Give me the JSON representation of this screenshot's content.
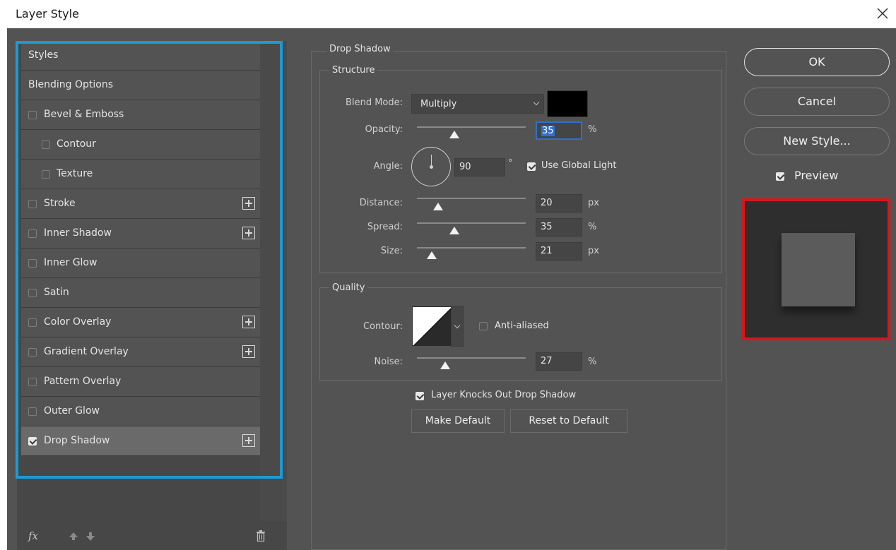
{
  "window": {
    "title": "Layer Style"
  },
  "styles_list": {
    "items": [
      {
        "label": "Styles",
        "checkbox": false,
        "checked": false,
        "add": false,
        "selected": false,
        "indent": 0
      },
      {
        "label": "Blending Options",
        "checkbox": false,
        "checked": false,
        "add": false,
        "selected": false,
        "indent": 0
      },
      {
        "label": "Bevel & Emboss",
        "checkbox": true,
        "checked": false,
        "add": false,
        "selected": false,
        "indent": 0
      },
      {
        "label": "Contour",
        "checkbox": true,
        "checked": false,
        "add": false,
        "selected": false,
        "indent": 1
      },
      {
        "label": "Texture",
        "checkbox": true,
        "checked": false,
        "add": false,
        "selected": false,
        "indent": 1
      },
      {
        "label": "Stroke",
        "checkbox": true,
        "checked": false,
        "add": true,
        "selected": false,
        "indent": 0
      },
      {
        "label": "Inner Shadow",
        "checkbox": true,
        "checked": false,
        "add": true,
        "selected": false,
        "indent": 0
      },
      {
        "label": "Inner Glow",
        "checkbox": true,
        "checked": false,
        "add": false,
        "selected": false,
        "indent": 0
      },
      {
        "label": "Satin",
        "checkbox": true,
        "checked": false,
        "add": false,
        "selected": false,
        "indent": 0
      },
      {
        "label": "Color Overlay",
        "checkbox": true,
        "checked": false,
        "add": true,
        "selected": false,
        "indent": 0
      },
      {
        "label": "Gradient Overlay",
        "checkbox": true,
        "checked": false,
        "add": true,
        "selected": false,
        "indent": 0
      },
      {
        "label": "Pattern Overlay",
        "checkbox": true,
        "checked": false,
        "add": false,
        "selected": false,
        "indent": 0
      },
      {
        "label": "Outer Glow",
        "checkbox": true,
        "checked": false,
        "add": false,
        "selected": false,
        "indent": 0
      },
      {
        "label": "Drop Shadow",
        "checkbox": true,
        "checked": true,
        "add": true,
        "selected": true,
        "indent": 0
      }
    ],
    "fx_label": "fx"
  },
  "drop_shadow": {
    "title": "Drop Shadow",
    "structure": {
      "title": "Structure",
      "blend_mode_label": "Blend Mode:",
      "blend_mode_value": "Multiply",
      "shadow_color": "#000000",
      "opacity_label": "Opacity:",
      "opacity_value": "35",
      "opacity_unit": "%",
      "angle_label": "Angle:",
      "angle_value": "90",
      "angle_unit": "°",
      "use_global_light_label": "Use Global Light",
      "use_global_light_checked": true,
      "distance_label": "Distance:",
      "distance_value": "20",
      "distance_unit": "px",
      "spread_label": "Spread:",
      "spread_value": "35",
      "spread_unit": "%",
      "size_label": "Size:",
      "size_value": "21",
      "size_unit": "px"
    },
    "quality": {
      "title": "Quality",
      "contour_label": "Contour:",
      "anti_aliased_label": "Anti-aliased",
      "anti_aliased_checked": false,
      "noise_label": "Noise:",
      "noise_value": "27",
      "noise_unit": "%"
    },
    "layer_knocks_out_label": "Layer Knocks Out Drop Shadow",
    "layer_knocks_out_checked": true,
    "make_default_label": "Make Default",
    "reset_default_label": "Reset to Default"
  },
  "actions": {
    "ok_label": "OK",
    "cancel_label": "Cancel",
    "new_style_label": "New Style...",
    "preview_label": "Preview",
    "preview_checked": true
  },
  "colors": {
    "dialog_bg": "#535353",
    "highlight_blue": "#1c9ad6",
    "highlight_red": "#d7161c"
  }
}
